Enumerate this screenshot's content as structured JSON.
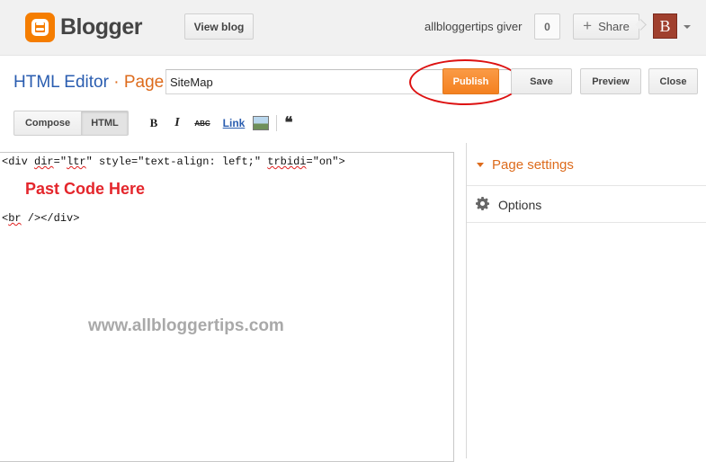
{
  "header": {
    "logo_text": "Blogger",
    "view_blog": "View blog",
    "username": "allbloggertips giver",
    "notification_count": "0",
    "share": "Share",
    "avatar_letter": "B"
  },
  "editor_bar": {
    "mode": "HTML Editor",
    "separator": "·",
    "type": "Page",
    "title_value": "SiteMap",
    "publish": "Publish",
    "save": "Save",
    "preview": "Preview",
    "close": "Close"
  },
  "toolbar": {
    "compose": "Compose",
    "html": "HTML",
    "bold": "B",
    "italic": "I",
    "strike": "ABC",
    "link": "Link",
    "quote": "❝"
  },
  "content": {
    "line1_a": "<div ",
    "line1_dir": "dir",
    "line1_b": "=\"",
    "line1_ltr": "ltr",
    "line1_c": "\" style=\"text-align: left;\" ",
    "line1_trbidi": "trbidi",
    "line1_d": "=\"on\">",
    "annotation": "Past Code Here",
    "line2_a": "<",
    "line2_br": "br",
    "line2_b": " /></div>",
    "watermark": "www.allbloggertips.com"
  },
  "sidebar": {
    "page_settings": "Page settings",
    "options": "Options"
  },
  "colors": {
    "accent_orange": "#f48120",
    "link_blue": "#2a5db0",
    "annotation_red": "#e4262c"
  }
}
